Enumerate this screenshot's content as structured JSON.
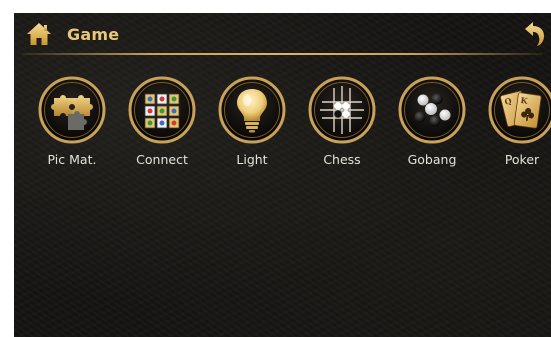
{
  "header": {
    "title": "Game",
    "home_icon": "home-icon",
    "back_icon": "back-arrow-icon"
  },
  "apps": [
    {
      "label": "Pic Mat.",
      "icon": "puzzle-icon"
    },
    {
      "label": "Connect",
      "icon": "connect-tiles-icon"
    },
    {
      "label": "Light",
      "icon": "light-bulb-icon"
    },
    {
      "label": "Chess",
      "icon": "chess-board-icon"
    },
    {
      "label": "Gobang",
      "icon": "gobang-stones-icon"
    },
    {
      "label": "Poker",
      "icon": "playing-cards-icon"
    }
  ],
  "colors": {
    "accent_gold": "#e8c77a",
    "ring_gold": "#c9a25a",
    "background": "#141311"
  }
}
